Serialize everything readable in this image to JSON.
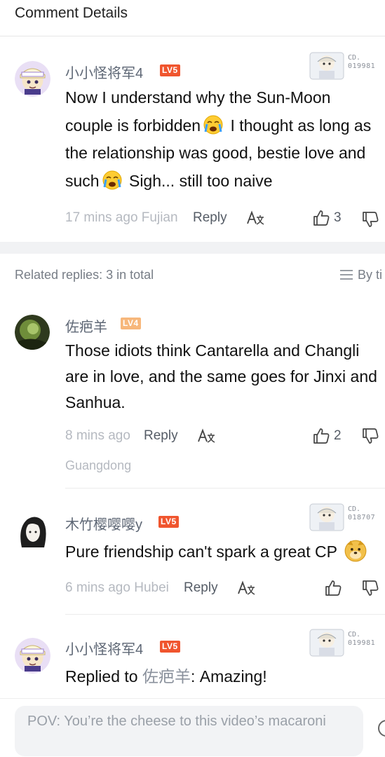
{
  "header": {
    "title": "Comment Details"
  },
  "main_comment": {
    "username": "小小怪将军4",
    "level": "LV5",
    "badge_code": {
      "top": "CD.",
      "number": "019981"
    },
    "text_lines": [
      [
        "Now I understand why the Sun-Moon",
        ""
      ],
      [
        "couple is forbidden",
        " I thought as long as"
      ],
      [
        "the relationship was good, bestie love and",
        ""
      ],
      [
        "such",
        " Sigh... still too naive"
      ]
    ],
    "time": "17 mins ago",
    "location": "Fujian",
    "reply_label": "Reply",
    "likes": "3"
  },
  "related": {
    "label": "Related replies: 3 in total",
    "sort_label": "By ti"
  },
  "replies": [
    {
      "username": "佐疤羊",
      "level": "LV4",
      "text_lines": [
        "Those idiots think Cantarella and Changli",
        "are in love, and the same goes for Jinxi and",
        "Sanhua."
      ],
      "time": "8 mins ago",
      "location": "Guangdong",
      "reply_label": "Reply",
      "likes": "2"
    },
    {
      "username": "木竹樱嘤嘤y",
      "level": "LV5",
      "badge_code": {
        "top": "CD.",
        "number": "018707"
      },
      "text": "Pure friendship can't spark a great CP",
      "time": "6 mins ago",
      "location": "Hubei",
      "reply_label": "Reply",
      "likes": ""
    },
    {
      "username": "小小怪将军4",
      "level": "LV5",
      "badge_code": {
        "top": "CD.",
        "number": "019981"
      },
      "replied_prefix": "Replied to ",
      "replied_user": "佐疤羊",
      "replied_text": ": Amazing!"
    }
  ],
  "input": {
    "placeholder": "POV: You’re the cheese to this video’s macaroni"
  },
  "icons": {
    "like": "thumbs-up-icon",
    "dislike": "thumbs-down-icon",
    "translate": "translate-icon",
    "sort": "list-sort-icon",
    "cry_emoji": "crying-face-emoji",
    "doge_emoji": "doge-emoji"
  },
  "colors": {
    "level5": "#f0552e",
    "level4": "#f7b77b",
    "meta": "#b5b9c0",
    "username": "#5e6775"
  }
}
